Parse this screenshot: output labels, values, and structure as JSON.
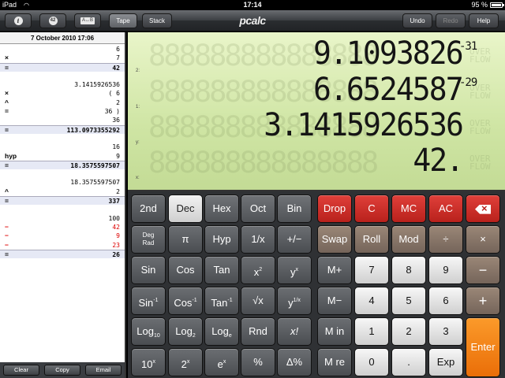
{
  "status": {
    "device": "iPad",
    "time": "17:14",
    "battery": "95 %"
  },
  "toolbar": {
    "info_glyph": "i",
    "answer_glyph": "42",
    "swap_label": "A↔B",
    "tape_label": "Tape",
    "stack_label": "Stack",
    "logo": "pcalc",
    "undo_label": "Undo",
    "redo_label": "Redo",
    "help_label": "Help"
  },
  "tape": {
    "date": "7 October 2010 17:06",
    "lines": [
      {
        "op": "",
        "val": "6",
        "kind": ""
      },
      {
        "op": "×",
        "val": "7",
        "kind": ""
      },
      {
        "op": "=",
        "val": "42",
        "kind": "res"
      },
      {
        "op": "",
        "val": "",
        "kind": "blank"
      },
      {
        "op": "",
        "val": "3.1415926536",
        "kind": ""
      },
      {
        "op": "×",
        "val": "( 6",
        "kind": ""
      },
      {
        "op": "^",
        "val": "2",
        "kind": ""
      },
      {
        "op": "=",
        "val": "36 )",
        "kind": ""
      },
      {
        "op": "",
        "val": "36",
        "kind": ""
      },
      {
        "op": "=",
        "val": "113.0973355292",
        "kind": "res"
      },
      {
        "op": "",
        "val": "",
        "kind": "blank"
      },
      {
        "op": "",
        "val": "16",
        "kind": ""
      },
      {
        "op": "hyp",
        "val": "9",
        "kind": ""
      },
      {
        "op": "=",
        "val": "18.3575597507",
        "kind": "res"
      },
      {
        "op": "",
        "val": "",
        "kind": "blank"
      },
      {
        "op": "",
        "val": "18.3575597507",
        "kind": ""
      },
      {
        "op": "^",
        "val": "2",
        "kind": ""
      },
      {
        "op": "=",
        "val": "337",
        "kind": "res"
      },
      {
        "op": "",
        "val": "",
        "kind": "blank"
      },
      {
        "op": "",
        "val": "100",
        "kind": ""
      },
      {
        "op": "−",
        "val": "42",
        "kind": "red"
      },
      {
        "op": "−",
        "val": "9",
        "kind": "red"
      },
      {
        "op": "−",
        "val": "23",
        "kind": "red"
      },
      {
        "op": "=",
        "val": "26",
        "kind": "res"
      }
    ],
    "footer": {
      "clear": "Clear",
      "copy": "Copy",
      "email": "Email"
    }
  },
  "display": {
    "ghost_digits": "888888888888888",
    "ghost_side": [
      "OVER",
      "FLOW"
    ],
    "registers": [
      {
        "label": "2:",
        "value": "9.1093826",
        "exp": "-31"
      },
      {
        "label": "1:",
        "value": "6.6524587",
        "exp": "-29"
      },
      {
        "label": "y:",
        "value": "3.1415926536",
        "exp": ""
      },
      {
        "label": "x:",
        "value": "42.",
        "exp": ""
      }
    ]
  },
  "keys": {
    "row1": [
      "2nd",
      "Dec",
      "Hex",
      "Oct",
      "Bin",
      "Drop",
      "C",
      "MC",
      "AC"
    ],
    "row2": [
      "Deg",
      "Rad",
      "π",
      "Hyp",
      "1/x",
      "+/−",
      "Swap",
      "Roll",
      "Mod",
      "÷",
      "×"
    ],
    "row3": [
      "Sin",
      "Cos",
      "Tan",
      "x",
      "2",
      "y",
      "x",
      "M+",
      "7",
      "8",
      "9",
      "−"
    ],
    "row4": [
      "Sin",
      "-1",
      "Cos",
      "-1",
      "Tan",
      "-1",
      "√x",
      "y",
      "1/x",
      "M−",
      "4",
      "5",
      "6",
      "+"
    ],
    "row5": [
      "Log",
      "10",
      "Log",
      "2",
      "Log",
      "e",
      "Rnd",
      "x!",
      "M in",
      "1",
      "2",
      "3",
      "Enter"
    ],
    "row6": [
      "10",
      "x",
      "2",
      "x",
      "e",
      "x",
      "%",
      "Δ%",
      "M re",
      "0",
      ".",
      "Exp"
    ]
  },
  "colors": {
    "accent_red": "#c8231e",
    "enter_orange": "#f38416",
    "lcd_green": "#d6eab0"
  }
}
